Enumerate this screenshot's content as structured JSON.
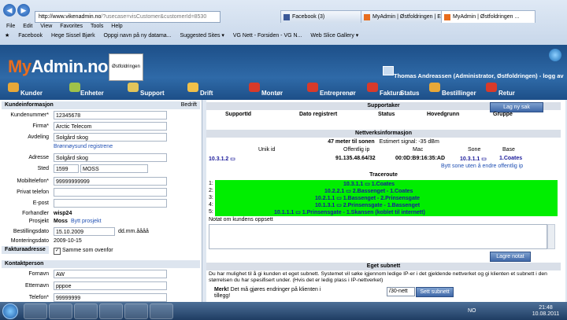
{
  "browser": {
    "url_host": "http://www.vikenadmin.no",
    "url_rest": "/?usecase=visCustomer&customerId=8530",
    "tabs": [
      "Facebook (3)",
      "MyAdmin | Østfoldringen | E...",
      "MyAdmin | Østfoldringen ..."
    ],
    "menu": [
      "File",
      "Edit",
      "View",
      "Favorites",
      "Tools",
      "Help"
    ],
    "favorites": [
      "Facebook",
      "Hege Sissel Bjørk",
      "Oppgi navn på ny datama...",
      "Suggested Sites ▾",
      "VG Nett - Forsiden - VG N...",
      "Web Slice Gallery ▾"
    ]
  },
  "header": {
    "logo_my": "My",
    "logo_rest": "Admin.no",
    "org_logo": "Østfoldringen",
    "user": "Thomas Andreassen (Administrator, Østfoldringen) - logg av"
  },
  "nav": [
    "Kunder",
    "Enheter",
    "Support",
    "Drift",
    "Montør",
    "Entreprenør",
    "Faktura",
    "Status",
    "Bestillinger",
    "Retur"
  ],
  "customer": {
    "section_title": "Kundeinformasjon",
    "bedrift_label": "Bedrift",
    "fields": {
      "kundenummer_label": "Kundenummer*",
      "kundenummer": "12345678",
      "firma_label": "Firma*",
      "firma": "Arctic Telecom",
      "avdeling_label": "Avdeling",
      "avdeling": "Solgård skog",
      "bronnoysund": "Brønnøysund registrene",
      "adresse_label": "Adresse",
      "adresse": "Solgård skog",
      "sted_label": "Sted",
      "postnr": "1599",
      "poststed": "MOSS",
      "mobil_label": "Mobiltelefon*",
      "mobil": "99999999999",
      "privat_label": "Privat telefon",
      "privat": "",
      "epost_label": "E-post",
      "epost": "",
      "forhandler_label": "Forhandler",
      "forhandler": "wisp24",
      "prosjekt_label": "Prosjekt",
      "prosjekt": "Moss",
      "bytt_prosjekt": "Bytt prosjekt",
      "bestilling_label": "Bestillingsdato",
      "bestilling": "15.10.2009",
      "date_hint": "dd.mm.åååå",
      "montering_label": "Monteringsdato",
      "montering": "2009-10-15"
    },
    "faktura_title": "Fakturaadresse",
    "same_as_above": "Samme som ovenfor",
    "contact_title": "Kontaktperson",
    "contact": {
      "fornavn_label": "Fornavn",
      "fornavn": "AW",
      "etternavn_label": "Etternavn",
      "etternavn": "pppoe",
      "telefon_label": "Telefon*",
      "telefon": "99999999"
    }
  },
  "support": {
    "title": "Supportaker",
    "new_case": "Lag ny sak",
    "columns": [
      "SupportId",
      "Dato registrert",
      "Status",
      "Hovedgrunn",
      "Gruppe"
    ]
  },
  "network": {
    "title": "Nettverksinformasjon",
    "distance": "47 meter til sonen",
    "signal": "Estimert signal: -35 dBm",
    "columns": [
      "Unik id",
      "Offentlig ip",
      "Mac",
      "Sone",
      "Base"
    ],
    "unik_id": "10.3.1.2",
    "public_ip": "91.135.48.64/32",
    "mac": "00:0D:B9:16:35:AD",
    "sone": "10.3.1.1",
    "base": "1.Coates",
    "change_zone": "Bytt sone uten å endre offentlig ip"
  },
  "traceroute": {
    "title": "Traceroute",
    "hops": [
      {
        "n": "1:",
        "text": "10.3.1.1 ▭ 1.Coates"
      },
      {
        "n": "2:",
        "text": "10.2.2.1 ▭ 2.Bassenget - 1.Coates"
      },
      {
        "n": "3:",
        "text": "10.2.1.1 ▭ 1.Bassenget - 2.Prinsensgate"
      },
      {
        "n": "4:",
        "text": "10.1.3.1 ▭ 2.Prinsensgate - 1.Bassenget"
      },
      {
        "n": "5:",
        "text": "10.1.1.1 ▭ 1.Prinsensgate - 1.Skansen (koblet til internett)"
      }
    ]
  },
  "notes": {
    "label": "Notat om kundens oppsett",
    "save": "Lagre notat"
  },
  "subnet": {
    "title": "Eget subnett",
    "description": "Du har mulighet til å gi kunden et eget subnett. Systemet vil søke igjennom ledige IP-er i det gjeldende nettverket og gi klienten et subnett i den størrelsen du har spesifisert under. (Hvis det er ledig plass i IP-nettverket)",
    "note_bold": "Merk!",
    "note": "Det må gjøres endringer på klienten i tillegg!",
    "select_value": "/30-nett",
    "button": "Sett subnett"
  },
  "taskbar": {
    "lang": "NO",
    "time": "21:48",
    "date": "10.08.2011"
  }
}
